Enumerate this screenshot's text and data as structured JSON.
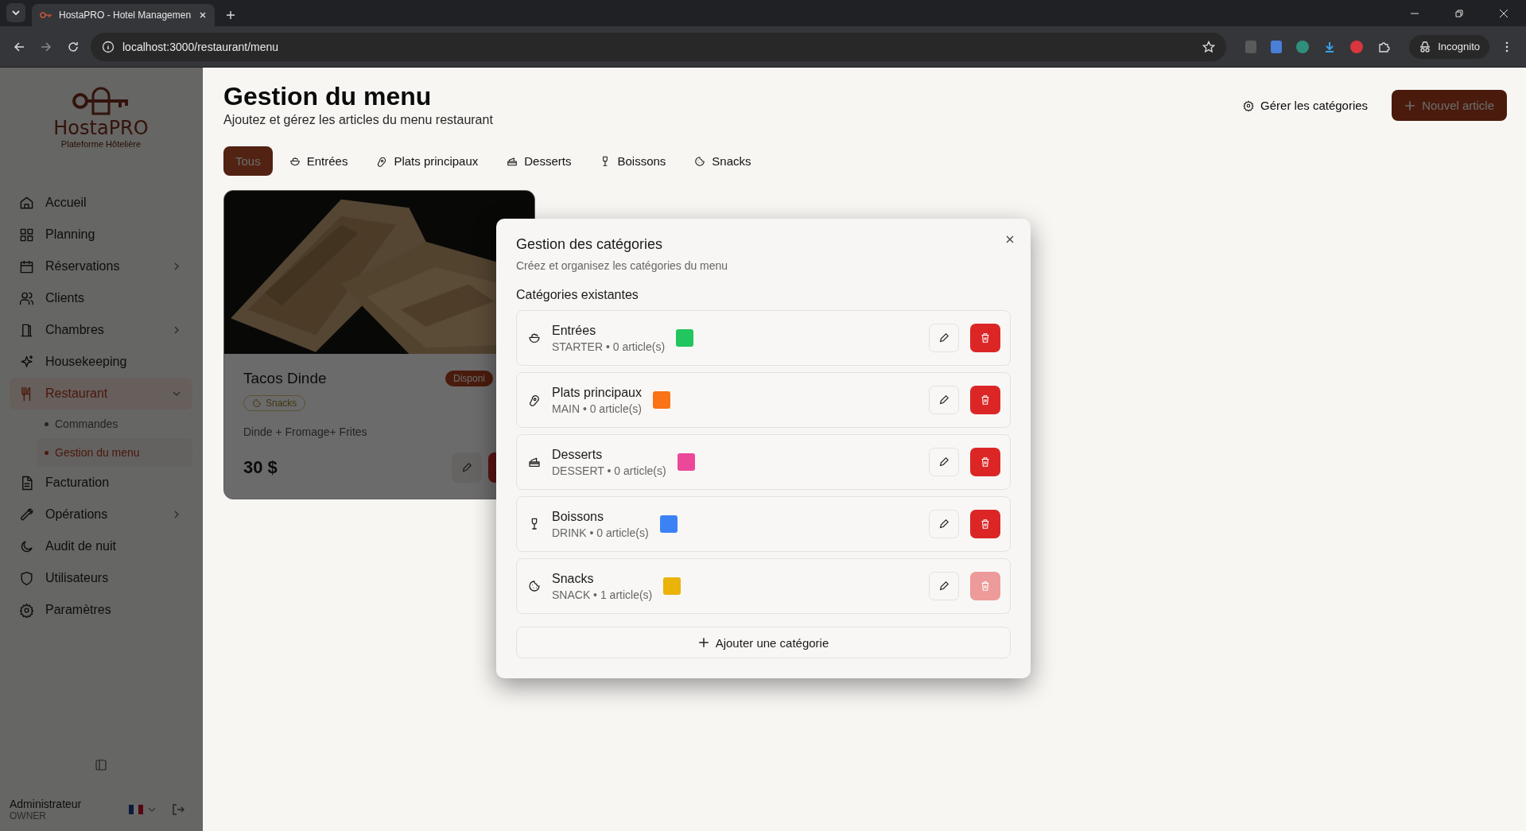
{
  "browser": {
    "tab_title": "HostaPRO - Hotel Managemen",
    "url": "localhost:3000/restaurant/menu",
    "profile": "Incognito"
  },
  "sidebar": {
    "logo": "HostaPRO",
    "tagline": "Plateforme Hôtelière",
    "items": [
      {
        "label": "Accueil",
        "kind": "link",
        "selected": false
      },
      {
        "label": "Planning",
        "kind": "link",
        "selected": false
      },
      {
        "label": "Réservations",
        "kind": "group",
        "expanded": false,
        "selected": false
      },
      {
        "label": "Clients",
        "kind": "link",
        "selected": false
      },
      {
        "label": "Chambres",
        "kind": "group",
        "expanded": false,
        "selected": false
      },
      {
        "label": "Housekeeping",
        "kind": "link",
        "selected": false
      },
      {
        "label": "Restaurant",
        "kind": "group",
        "expanded": true,
        "selected": true,
        "children": [
          {
            "label": "Commandes",
            "selected": false
          },
          {
            "label": "Gestion du menu",
            "selected": true
          }
        ]
      },
      {
        "label": "Facturation",
        "kind": "link",
        "selected": false
      },
      {
        "label": "Opérations",
        "kind": "group",
        "expanded": false,
        "selected": false
      },
      {
        "label": "Audit de nuit",
        "kind": "link",
        "selected": false
      },
      {
        "label": "Utilisateurs",
        "kind": "link",
        "selected": false
      },
      {
        "label": "Paramètres",
        "kind": "link",
        "selected": false
      }
    ],
    "user": {
      "name": "Administrateur",
      "role": "OWNER"
    }
  },
  "page": {
    "title": "Gestion du menu",
    "subtitle": "Ajoutez et gérez les articles du menu restaurant",
    "manage_button": "Gérer les catégories",
    "new_button": "Nouvel article",
    "tabs": [
      {
        "label": "Tous",
        "selected": true
      },
      {
        "label": "Entrées",
        "selected": false
      },
      {
        "label": "Plats principaux",
        "selected": false
      },
      {
        "label": "Desserts",
        "selected": false
      },
      {
        "label": "Boissons",
        "selected": false
      },
      {
        "label": "Snacks",
        "selected": false
      }
    ],
    "items": [
      {
        "name": "Tacos Dinde",
        "status": "Disponi",
        "category": "Snacks",
        "description": "Dinde + Fromage+ Frites",
        "price": "30 $"
      }
    ]
  },
  "dialog": {
    "title": "Gestion des catégories",
    "subtitle": "Créez et organisez les catégories du menu",
    "section": "Catégories existantes",
    "categories": [
      {
        "name": "Entrées",
        "meta": "STARTER • 0 article(s)",
        "color": "#22c55e",
        "disabled": false
      },
      {
        "name": "Plats principaux",
        "meta": "MAIN • 0 article(s)",
        "color": "#f97316",
        "disabled": false
      },
      {
        "name": "Desserts",
        "meta": "DESSERT • 0 article(s)",
        "color": "#ec4899",
        "disabled": false
      },
      {
        "name": "Boissons",
        "meta": "DRINK • 0 article(s)",
        "color": "#3b82f6",
        "disabled": false
      },
      {
        "name": "Snacks",
        "meta": "SNACK • 1 article(s)",
        "color": "#eab308",
        "disabled": true
      }
    ],
    "add_button": "Ajouter une catégorie"
  }
}
